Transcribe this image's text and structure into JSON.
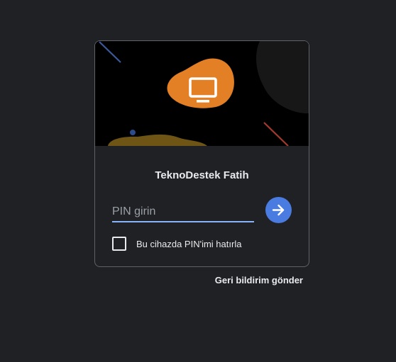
{
  "device_name": "TeknoDestek Fatih",
  "pin_input": {
    "placeholder": "PIN girin",
    "value": ""
  },
  "remember_label": "Bu cihazda PIN'imi hatırla",
  "feedback_link": "Geri bildirim gönder",
  "icons": {
    "banner_icon": "monitor-icon",
    "submit_icon": "arrow-right-icon"
  },
  "colors": {
    "background": "#202124",
    "accent_blue": "#4a7be0",
    "orange_blob": "#e37f24",
    "input_underline": "#8ab4f8"
  }
}
